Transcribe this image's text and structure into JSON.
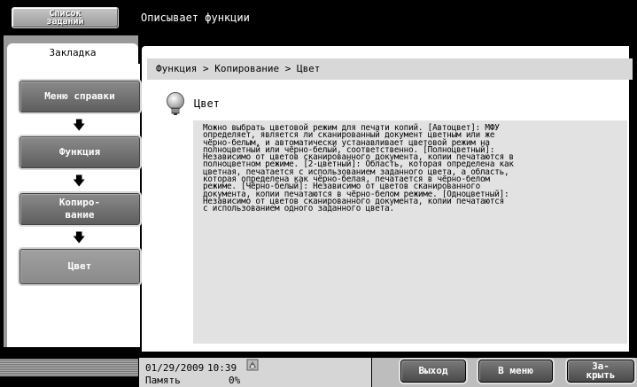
{
  "header": {
    "job_list_line1": "Список",
    "job_list_line2": "заданий",
    "title": "Описывает функции"
  },
  "sidebar": {
    "tab_label": "Закладка",
    "items": [
      {
        "label": "Меню справки"
      },
      {
        "label": "Функция"
      },
      {
        "label_line1": "Копиро-",
        "label_line2": "вание"
      },
      {
        "label": "Цвет"
      }
    ],
    "arrow": "➜"
  },
  "breadcrumb": "Функция > Копирование > Цвет",
  "section": {
    "title": "Цвет",
    "icon": "lightbulb-icon",
    "description": "Можно выбрать цветовой режим для печати копий. [Автоцвет]: МФУ\nопределяет, является ли сканированный документ цветным или же\nчёрно-белым, и автоматически устанавливает цветовой режим на\nполноцветный или чёрно-белый, соответственно. [Полноцветный]:\nНезависимо от цветов сканированного документа, копии печатаются в\nполноцветном режиме. [2-цветный]: Область, которая определена как\nцветная, печатается с использованием заданного цвета, а область,\nкоторая определена как чёрно-белая, печатается в чёрно-белом\nрежиме. [Чёрно-белый]: Независимо от цветов сканированного\nдокумента, копии печатаются в чёрно-белом режиме. [Одноцветный]:\nНезависимо от цветов сканированного документа, копии печатаются\nс использованием одного заданного цвета."
  },
  "status": {
    "date": "01/29/2009",
    "time": "10:39",
    "memory_label": "Память",
    "memory_value": "0%"
  },
  "footer_buttons": {
    "exit": "Выход",
    "menu": "В меню",
    "close_line1": "За-",
    "close_line2": "крыть"
  }
}
